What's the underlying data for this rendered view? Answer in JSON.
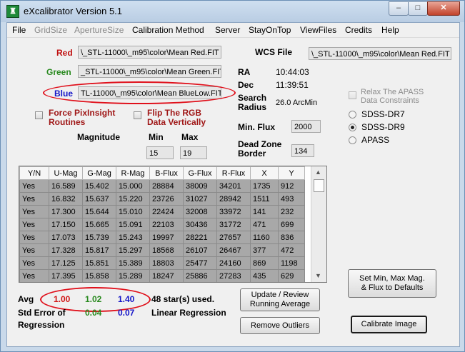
{
  "window": {
    "title": "eXcalibrator Version 5.1",
    "controls": [
      "–",
      "□",
      "✕"
    ]
  },
  "menu": [
    "File",
    "GridSize",
    "ApertureSize",
    "Calibration Method",
    "Server",
    "StayOnTop",
    "ViewFiles",
    "Credits",
    "Help"
  ],
  "files": {
    "red_label": "Red",
    "red_value": "\\_STL-11000\\_m95\\color\\Mean Red.FIT",
    "green_label": "Green",
    "green_value": "_STL-11000\\_m95\\color\\Mean Green.FIT",
    "blue_label": "Blue",
    "blue_value": "TL-11000\\_m95\\color\\Mean BlueLow.FIT",
    "wcs_label": "WCS File",
    "wcs_value": "\\_STL-11000\\_m95\\color\\Mean Red.FIT"
  },
  "colors": {
    "red": "#c01010",
    "green": "#2a8a20",
    "blue": "#1515c8"
  },
  "coords": {
    "ra_label": "RA",
    "ra_value": "10:44:03",
    "dec_label": "Dec",
    "dec_value": "11:39:51",
    "radius_label_1": "Search",
    "radius_label_2": "Radius",
    "radius_value": "26.0 ArcMin"
  },
  "options": {
    "force_pix_1": "Force PixInsight",
    "force_pix_2": "Routines",
    "flip_1": "Flip The RGB",
    "flip_2": "Data Vertically"
  },
  "magnitude": {
    "label": "Magnitude",
    "min_label": "Min",
    "max_label": "Max",
    "min_value": "15",
    "max_value": "19"
  },
  "flux": {
    "min_flux_label": "Min. Flux",
    "min_flux_value": "2000",
    "dead_zone_1": "Dead Zone",
    "dead_zone_2": "Border",
    "dead_zone_value": "134"
  },
  "catalog": {
    "relax_1": "Relax The APASS",
    "relax_2": "Data Constraints",
    "options": [
      "SDSS-DR7",
      "SDSS-DR9",
      "APASS"
    ],
    "selected": "SDSS-DR9"
  },
  "table": {
    "columns": [
      "Y/N",
      "U-Mag",
      "G-Mag",
      "R-Mag",
      "B-Flux",
      "G-Flux",
      "R-Flux",
      "X",
      "Y"
    ],
    "rows": [
      [
        "Yes",
        "16.589",
        "15.402",
        "15.000",
        "28884",
        "38009",
        "34201",
        "1735",
        "912"
      ],
      [
        "Yes",
        "16.832",
        "15.637",
        "15.220",
        "23726",
        "31027",
        "28942",
        "1511",
        "493"
      ],
      [
        "Yes",
        "17.300",
        "15.644",
        "15.010",
        "22424",
        "32008",
        "33972",
        "141",
        "232"
      ],
      [
        "Yes",
        "17.150",
        "15.665",
        "15.091",
        "22103",
        "30436",
        "31772",
        "471",
        "699"
      ],
      [
        "Yes",
        "17.073",
        "15.739",
        "15.243",
        "19997",
        "28221",
        "27657",
        "1160",
        "836"
      ],
      [
        "Yes",
        "17.328",
        "15.817",
        "15.297",
        "18568",
        "26107",
        "26467",
        "377",
        "472"
      ],
      [
        "Yes",
        "17.125",
        "15.851",
        "15.389",
        "18803",
        "25477",
        "24160",
        "869",
        "1198"
      ],
      [
        "Yes",
        "17.395",
        "15.858",
        "15.289",
        "18247",
        "25886",
        "27283",
        "435",
        "629"
      ]
    ]
  },
  "results": {
    "avg_label": "Avg",
    "avg_red": "1.00",
    "avg_green": "1.02",
    "avg_blue": "1.40",
    "stars_used": "48 star(s) used.",
    "std_label_1": "Std Error of",
    "std_label_2": "Regression",
    "std_green": "0.04",
    "std_blue": "0.07",
    "method": "Linear Regression"
  },
  "buttons": {
    "update_1": "Update / Review",
    "update_2": "Running Average",
    "remove": "Remove Outliers",
    "setmin_1": "Set Min, Max Mag.",
    "setmin_2": "& Flux to Defaults",
    "calibrate": "Calibrate Image"
  }
}
